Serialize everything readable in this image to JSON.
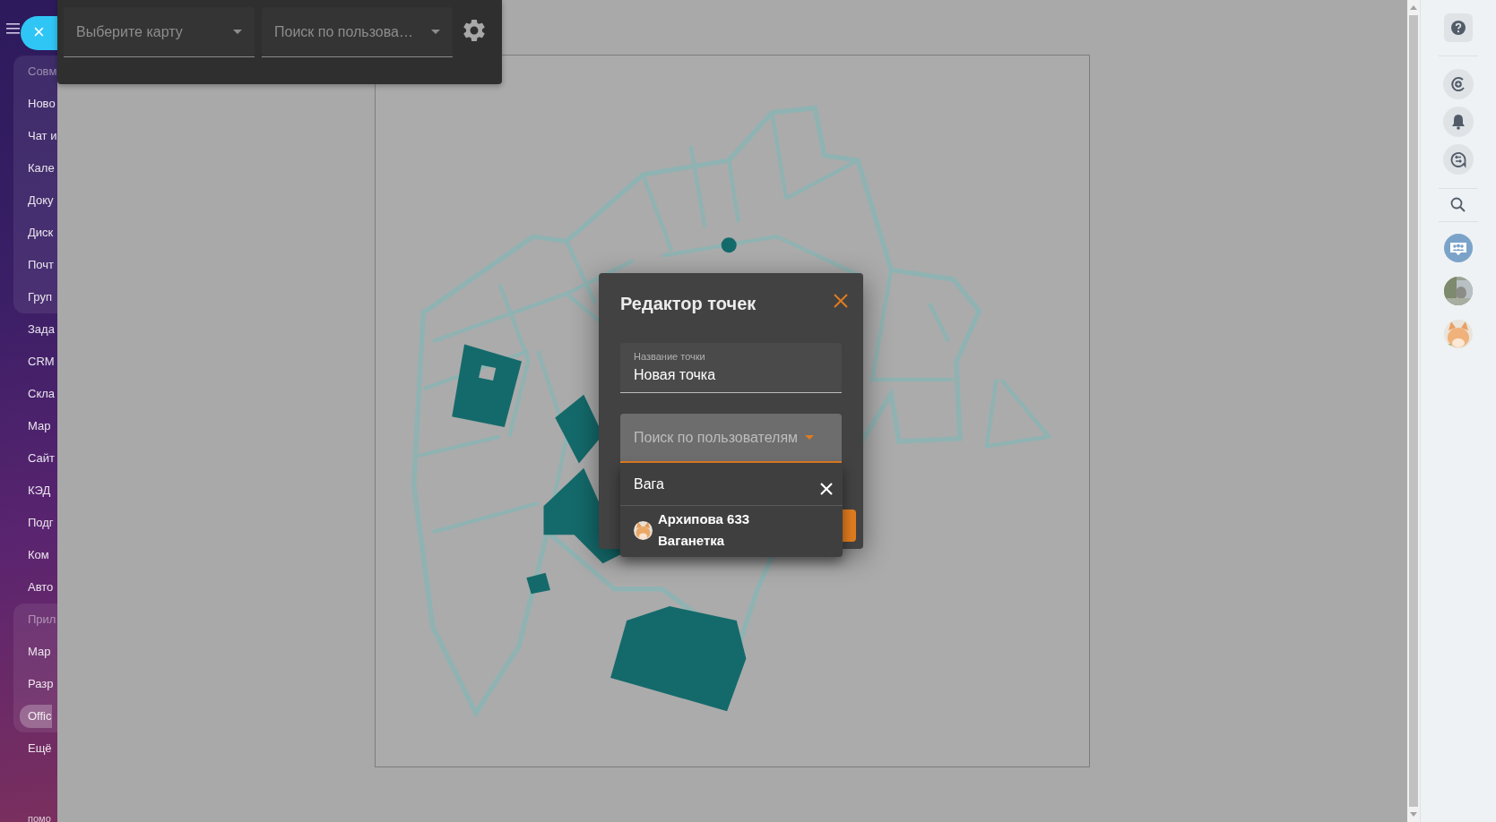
{
  "close_button": {
    "label": "×"
  },
  "left_menu": {
    "sections": [
      {
        "boxed": true,
        "items": [
          {
            "label": "Совм",
            "kind": "header"
          },
          {
            "label": "Ново",
            "kind": "item",
            "selected": false
          },
          {
            "label": "Чат и",
            "kind": "item",
            "selected": false
          },
          {
            "label": "Кале",
            "kind": "item",
            "selected": false
          },
          {
            "label": "Доку",
            "kind": "item",
            "selected": false
          },
          {
            "label": "Диск",
            "kind": "item",
            "selected": false
          },
          {
            "label": "Почт",
            "kind": "item",
            "selected": false
          },
          {
            "label": "Груп",
            "kind": "item",
            "selected": false
          }
        ]
      },
      {
        "boxed": false,
        "items": [
          {
            "label": "Зада",
            "kind": "item",
            "selected": false
          },
          {
            "label": "CRM",
            "kind": "item",
            "selected": false
          },
          {
            "label": "Скла",
            "kind": "item",
            "selected": false
          },
          {
            "label": "Мар",
            "kind": "item",
            "selected": false
          },
          {
            "label": "Сайт",
            "kind": "item",
            "selected": false
          },
          {
            "label": "КЭД",
            "kind": "item",
            "selected": false
          },
          {
            "label": "Подг",
            "kind": "item",
            "selected": false
          },
          {
            "label": "Ком",
            "kind": "item",
            "selected": false
          },
          {
            "label": "Авто",
            "kind": "item",
            "selected": false
          }
        ]
      },
      {
        "boxed": true,
        "items": [
          {
            "label": "Прил",
            "kind": "header"
          },
          {
            "label": "Мар",
            "kind": "item",
            "selected": false
          },
          {
            "label": "Разр",
            "kind": "item",
            "selected": false
          },
          {
            "label": "Offic",
            "kind": "item",
            "selected": true
          }
        ]
      },
      {
        "boxed": false,
        "items": [
          {
            "label": "Ещё",
            "kind": "item",
            "selected": false
          }
        ]
      }
    ],
    "footer": "помо"
  },
  "toolbar": {
    "map_select": {
      "placeholder": "Выберите карту"
    },
    "user_search": {
      "placeholder": "Поиск по пользова…"
    }
  },
  "dialog": {
    "title": "Редактор точек",
    "name_field": {
      "label": "Название точки",
      "value": "Новая точка"
    },
    "user_select": {
      "placeholder": "Поиск по пользователям",
      "open": true
    },
    "dropdown": {
      "query": "Вага",
      "results": [
        {
          "name": "Архипова 633 Ваганетка"
        }
      ]
    }
  }
}
